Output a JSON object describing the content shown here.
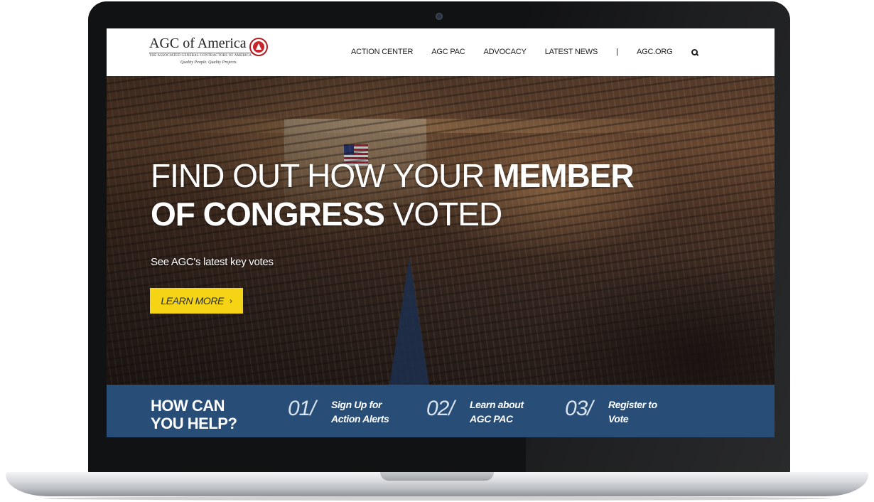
{
  "logo": {
    "title": "AGC of America",
    "subtitle": "THE ASSOCIATED GENERAL CONTRACTORS OF AMERICA",
    "tagline": "Quality People. Quality Projects."
  },
  "nav": {
    "items": [
      {
        "label": "ACTION CENTER"
      },
      {
        "label": "AGC PAC"
      },
      {
        "label": "ADVOCACY"
      },
      {
        "label": "LATEST NEWS"
      }
    ],
    "separator": "|",
    "external": "AGC.ORG"
  },
  "hero": {
    "headline_thin_1": "FIND OUT HOW YOUR ",
    "headline_bold_1": "MEMBER",
    "headline_bold_2": "OF CONGRESS",
    "headline_thin_2": " VOTED",
    "subtitle": "See AGC's latest key votes",
    "cta_label": "LEARN MORE",
    "cta_arrow": "›"
  },
  "help": {
    "title_line1": "HOW CAN",
    "title_line2": "YOU HELP?",
    "steps": [
      {
        "number": "01/",
        "line1": "Sign Up for",
        "line2": "Action Alerts"
      },
      {
        "number": "02/",
        "line1": "Learn about",
        "line2": "AGC PAC"
      },
      {
        "number": "03/",
        "line1": "Register to",
        "line2": "Vote"
      }
    ]
  },
  "colors": {
    "accent_yellow": "#f5d416",
    "band_blue": "#284e78",
    "logo_red": "#c8242b"
  }
}
